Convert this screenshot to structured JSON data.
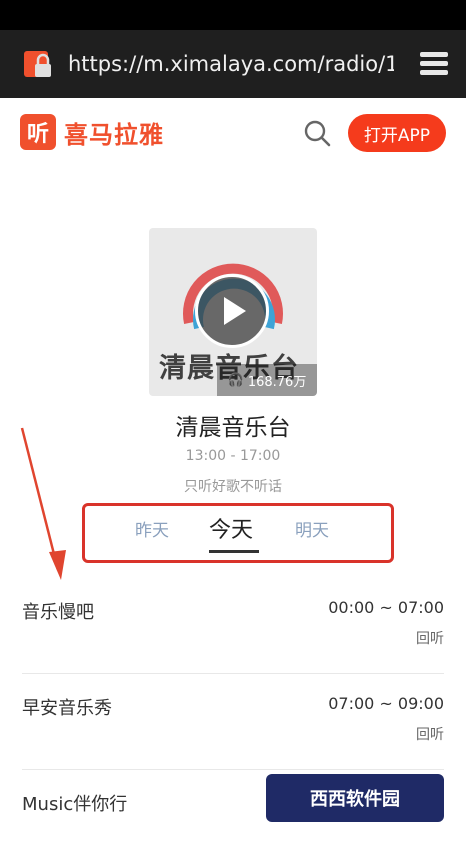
{
  "browser": {
    "url": "https://m.ximalaya.com/radio/1"
  },
  "header": {
    "logo_glyph": "听",
    "logo_text": "喜马拉雅",
    "open_app": "打开APP"
  },
  "station": {
    "cover_text": "清晨音乐台",
    "plays": "168.76万",
    "name": "清晨音乐台",
    "time": "13:00 - 17:00",
    "desc": "只听好歌不听话"
  },
  "day_tabs": [
    "昨天",
    "今天",
    "明天"
  ],
  "programs": [
    {
      "name": "音乐慢吧",
      "time": "00:00 ~ 07:00",
      "action": "回听"
    },
    {
      "name": "早安音乐秀",
      "time": "07:00 ~ 09:00",
      "action": "回听"
    },
    {
      "name": "Music伴你行",
      "time": "",
      "action": ""
    }
  ],
  "watermark": {
    "text": "西西软件园"
  },
  "colors": {
    "brand": "#f0502d",
    "button": "#f53b1c",
    "highlight_border": "#d9332a"
  }
}
